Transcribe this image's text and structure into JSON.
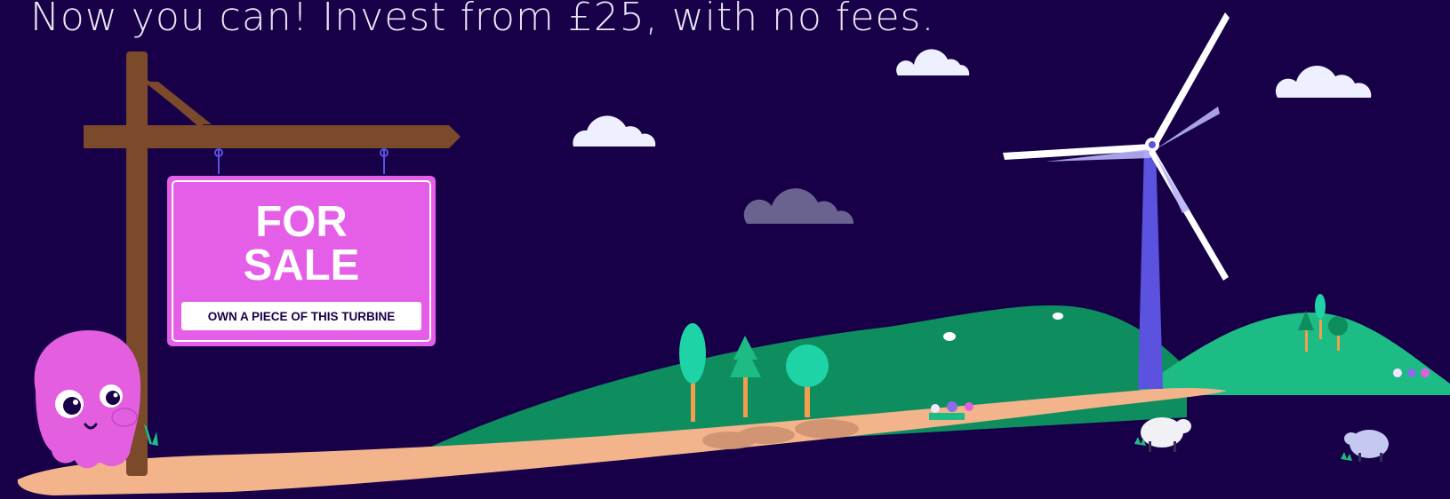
{
  "headline": "Now you can! Invest from £25, with no fees.",
  "sign": {
    "line1": "FOR",
    "line2": "SALE",
    "subtitle": "OWN A PIECE OF THIS TURBINE"
  },
  "colors": {
    "background": "#180048",
    "sign_pink": "#e55ee8",
    "turbine_blue": "#5b52e0",
    "hill_dark_green": "#0e8d5e",
    "hill_light_green": "#1ebc85",
    "path_peach": "#f4b48b",
    "post_brown": "#7a4a2a",
    "octopus_pink": "#e35fe0"
  },
  "icons": [
    "octopus-mascot-icon",
    "wind-turbine-icon",
    "sheep-icon",
    "tree-icon",
    "cloud-icon",
    "flower-icon"
  ]
}
